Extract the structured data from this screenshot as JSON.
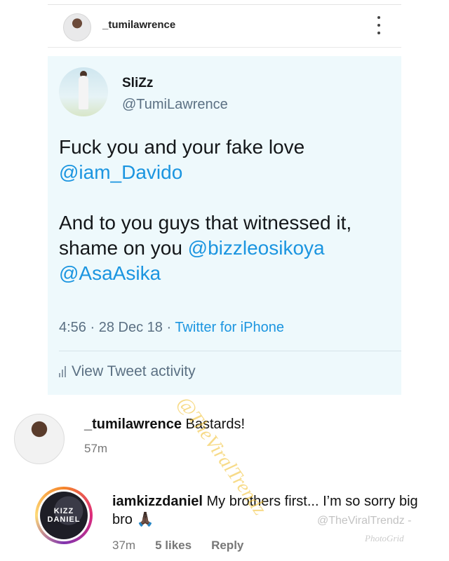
{
  "post": {
    "username": "_tumilawrence"
  },
  "tweet": {
    "display_name": "SliZz",
    "handle": "@TumiLawrence",
    "text_1": "Fuck you and your fake love",
    "mention_1": "@iam_Davido",
    "text_2": "And to you guys that witnessed it, shame on you",
    "mention_2": "@bizzleosikoya",
    "mention_3": "@AsaAsika",
    "time": "4:56",
    "date": "28 Dec 18",
    "source": "Twitter for iPhone",
    "activity_label": "View Tweet activity"
  },
  "comments": [
    {
      "username": "_tumilawrence",
      "text": "Bastards!",
      "time": "57m"
    },
    {
      "username": "iamkizzdaniel",
      "text": "My brothers first... I’m so sorry big bro 🙏🏿",
      "time": "37m",
      "likes": "5 likes",
      "reply_label": "Reply",
      "avatar_text_1": "KIZZ",
      "avatar_text_2": "DANIEL"
    }
  ],
  "watermarks": {
    "main": "@TheViralTrendz",
    "secondary": "@TheViralTrendz -",
    "app": "PhotoGrid"
  },
  "colors": {
    "link": "#1b95e0",
    "card_bg": "#eef9fc",
    "meta_gray": "#5b7083"
  }
}
